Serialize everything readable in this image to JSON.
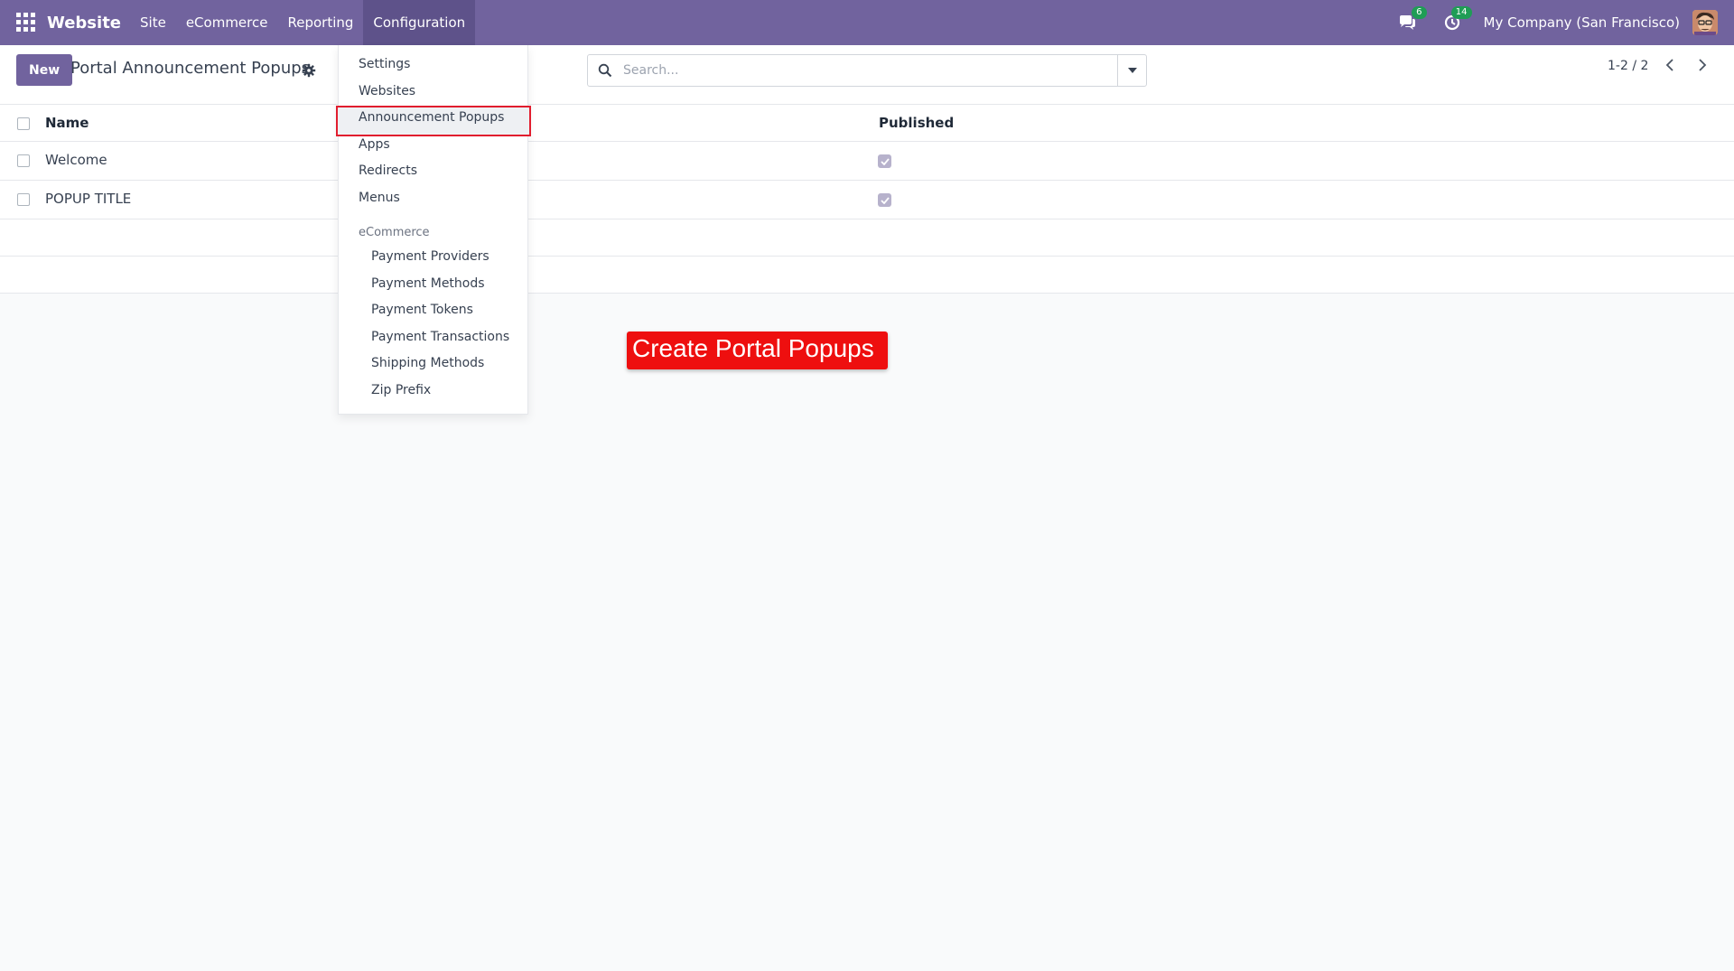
{
  "navbar": {
    "brand": "Website",
    "menu": [
      "Site",
      "eCommerce",
      "Reporting",
      "Configuration"
    ],
    "active_menu": "Configuration",
    "messages_count": "6",
    "activities_count": "14",
    "company": "My Company (San Francisco)"
  },
  "control_panel": {
    "new_label": "New",
    "title": "Portal Announcement Popups",
    "search_placeholder": "Search...",
    "pager": "1-2 / 2"
  },
  "list": {
    "columns": {
      "name": "Name",
      "published": "Published"
    },
    "rows": [
      {
        "name": "Welcome",
        "published": true
      },
      {
        "name": "POPUP TITLE",
        "published": true
      }
    ]
  },
  "dropdown": {
    "items": [
      "Settings",
      "Websites",
      "Announcement Popups",
      "Apps",
      "Redirects",
      "Menus"
    ],
    "highlighted": "Announcement Popups",
    "section": "eCommerce",
    "sub_items": [
      "Payment Providers",
      "Payment Methods",
      "Payment Tokens",
      "Payment Transactions",
      "Shipping Methods",
      "Zip Prefix"
    ]
  },
  "annotation": {
    "text": "Create Portal Popups"
  },
  "colors": {
    "brand": "#71639e",
    "highlight_border": "#e11d2e",
    "annotation_bg": "#ee0f0f",
    "badge": "#1f9d55"
  }
}
